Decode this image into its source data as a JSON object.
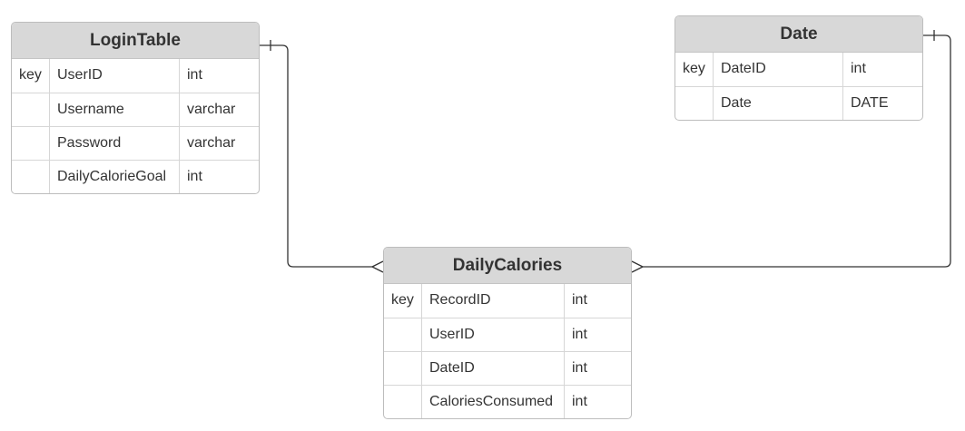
{
  "entities": {
    "login_table": {
      "title": "LoginTable",
      "rows": [
        {
          "key": "key",
          "field": "UserID",
          "type": "int"
        },
        {
          "key": "",
          "field": "Username",
          "type": "varchar"
        },
        {
          "key": "",
          "field": "Password",
          "type": "varchar"
        },
        {
          "key": "",
          "field": "DailyCalorieGoal",
          "type": "int"
        }
      ]
    },
    "date": {
      "title": "Date",
      "rows": [
        {
          "key": "key",
          "field": "DateID",
          "type": "int"
        },
        {
          "key": "",
          "field": "Date",
          "type": "DATE"
        }
      ]
    },
    "daily_calories": {
      "title": "DailyCalories",
      "rows": [
        {
          "key": "key",
          "field": "RecordID",
          "type": "int"
        },
        {
          "key": "",
          "field": "UserID",
          "type": "int"
        },
        {
          "key": "",
          "field": "DateID",
          "type": "int"
        },
        {
          "key": "",
          "field": "CaloriesConsumed",
          "type": "int"
        }
      ]
    }
  },
  "relationships": [
    {
      "from": "LoginTable",
      "to": "DailyCalories",
      "from_end": "one",
      "to_end": "many"
    },
    {
      "from": "Date",
      "to": "DailyCalories",
      "from_end": "one",
      "to_end": "many"
    }
  ],
  "colors": {
    "header_bg": "#d8d8d8",
    "border": "#bdbdbd",
    "grid": "#d6d6d6",
    "text": "#333333",
    "connector": "#333333"
  }
}
